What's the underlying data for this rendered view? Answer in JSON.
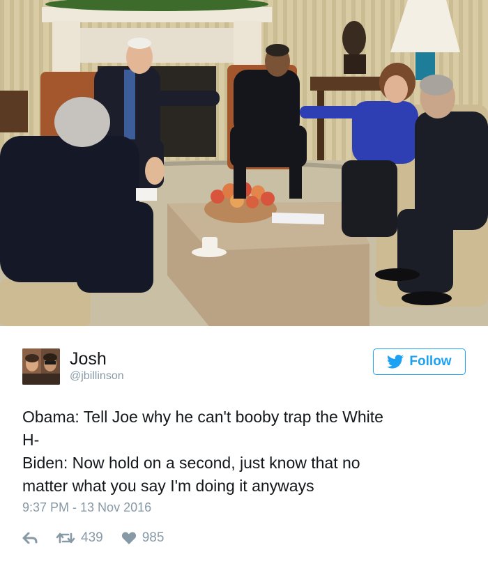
{
  "tweet": {
    "author_name": "Josh",
    "author_handle": "@jbillinson",
    "follow_label": "Follow",
    "text_lines": [
      "Obama: Tell Joe why he can't booby trap the White",
      "H-",
      "Biden: Now hold on a second, just know that no",
      "matter what you say I'm doing it anyways"
    ],
    "timestamp": "9:37 PM - 13 Nov 2016",
    "retweet_count": "439",
    "like_count": "985"
  },
  "icons": {
    "follow": "twitter-bird-icon",
    "reply": "reply-icon",
    "retweet": "retweet-icon",
    "like": "heart-icon"
  },
  "colors": {
    "twitter_blue": "#1da1f2",
    "muted_text": "#8899a6",
    "body_text": "#14171a"
  }
}
